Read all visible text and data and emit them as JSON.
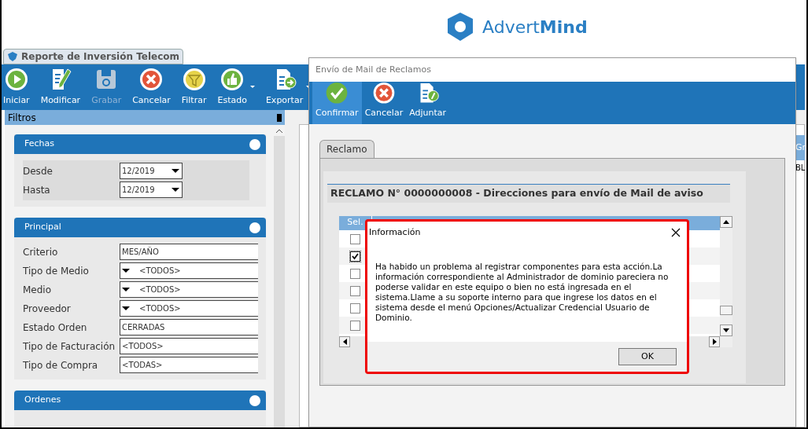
{
  "logo": {
    "text": "Advert**Mind**"
  },
  "main_window": {
    "tab": "Reporte de Inversión Telecom",
    "toolbar": [
      {
        "label": "Iniciar",
        "kind": "play",
        "disabled": false,
        "has_menu": false
      },
      {
        "label": "Modificar",
        "kind": "edit",
        "disabled": false,
        "has_menu": false
      },
      {
        "label": "Grabar",
        "kind": "save",
        "disabled": true,
        "has_menu": false
      },
      {
        "label": "Cancelar",
        "kind": "cancel",
        "disabled": false,
        "has_menu": false
      },
      {
        "label": "Filtrar",
        "kind": "filter",
        "disabled": false,
        "has_menu": false
      },
      {
        "label": "Estado",
        "kind": "thumb",
        "disabled": false,
        "has_menu": true
      },
      {
        "label": "Exportar",
        "kind": "export",
        "disabled": false,
        "has_menu": true
      }
    ],
    "filters": {
      "title": "Filtros",
      "groups": [
        {
          "title": "Fechas",
          "fields": [
            {
              "label": "Desde",
              "value": "12/2019",
              "kind": "date"
            },
            {
              "label": "Hasta",
              "value": "12/2019",
              "kind": "date"
            }
          ]
        },
        {
          "title": "Principal",
          "fields": [
            {
              "label": "Criterio",
              "value": "MES/AÑO",
              "kind": "combo"
            },
            {
              "label": "Tipo de Medio",
              "value": "<TODOS>",
              "kind": "check-combo"
            },
            {
              "label": "Medio",
              "value": "<TODOS>",
              "kind": "check-combo"
            },
            {
              "label": "Proveedor",
              "value": "<TODOS>",
              "kind": "check-combo"
            },
            {
              "label": "Estado Orden",
              "value": "CERRADAS",
              "kind": "combo"
            },
            {
              "label": "Tipo de Facturación",
              "value": "<TODOS>",
              "kind": "combo"
            },
            {
              "label": "Tipo de Compra",
              "value": "<TODAS>",
              "kind": "combo"
            }
          ]
        },
        {
          "title": "Ordenes"
        }
      ]
    },
    "grid": {
      "column_header": "Gr",
      "cell": "BL"
    }
  },
  "mail_dialog": {
    "title": "Envío de Mail de Reclamos",
    "toolbar": [
      {
        "label": "Confirmar",
        "kind": "check",
        "selected": true
      },
      {
        "label": "Cancelar",
        "kind": "cancel",
        "selected": false
      },
      {
        "label": "Adjuntar",
        "kind": "attach",
        "selected": false
      }
    ],
    "tabs": [
      {
        "label": "Reclamo",
        "selected": true
      }
    ],
    "heading": "RECLAMO N° 0000000008 - Direcciones para envío de Mail de aviso",
    "table": {
      "columns": [
        "Sel."
      ],
      "rows": [
        {
          "checked": false
        },
        {
          "checked": true
        },
        {
          "checked": false
        },
        {
          "checked": false
        },
        {
          "checked": false
        },
        {
          "checked": false
        }
      ]
    }
  },
  "info_dialog": {
    "title": "Información",
    "message": "Ha habido un problema al registrar componentes para esta acción.La información correspondiente al Administrador de dominio pareciera no poderse validar en este equipo o bien no está ingresada en el sistema.Llame a su soporte interno para que ingrese los datos en el sistema desde el menú Opciones/Actualizar Credencial Usuario de Dominio.",
    "ok": "OK"
  }
}
